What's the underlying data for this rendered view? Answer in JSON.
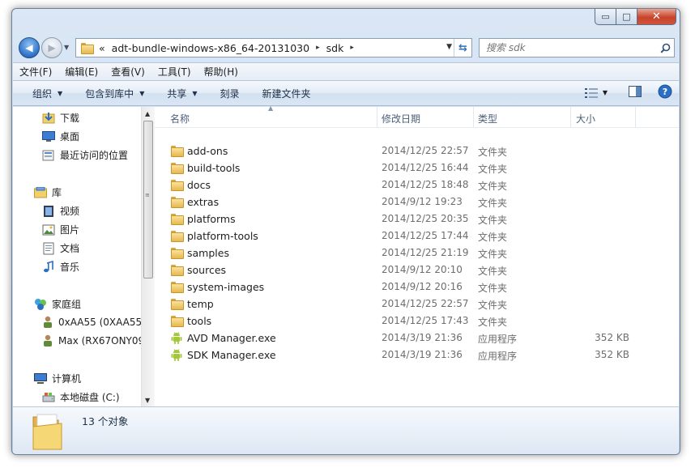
{
  "window": {
    "controls": {
      "minimize": "▭",
      "maximize": "□",
      "close": "✕"
    }
  },
  "address": {
    "overflow": "«",
    "crumbs": [
      "adt-bundle-windows-x86_64-20131030",
      "sdk"
    ],
    "separator": "▸"
  },
  "search": {
    "placeholder": "搜索 sdk"
  },
  "menu": [
    "文件(F)",
    "编辑(E)",
    "查看(V)",
    "工具(T)",
    "帮助(H)"
  ],
  "toolbar": {
    "organize": "组织",
    "include_library": "包含到库中",
    "share": "共享",
    "burn": "刻录",
    "new_folder": "新建文件夹"
  },
  "nav": {
    "favorites": [
      "下载",
      "桌面",
      "最近访问的位置"
    ],
    "library_title": "库",
    "libraries": [
      "视频",
      "图片",
      "文档",
      "音乐"
    ],
    "homegroup_title": "家庭组",
    "homegroup": [
      "0xAA55 (0XAA55-",
      "Max (RX67ONY09"
    ],
    "computer_title": "计算机",
    "computer": [
      "本地磁盘 (C:)"
    ]
  },
  "columns": {
    "name": "名称",
    "date": "修改日期",
    "type": "类型",
    "size": "大小"
  },
  "files": [
    {
      "name": "add-ons",
      "date": "2014/12/25 22:57",
      "type": "文件夹",
      "size": "",
      "icon": "folder-icon"
    },
    {
      "name": "build-tools",
      "date": "2014/12/25 16:44",
      "type": "文件夹",
      "size": "",
      "icon": "folder-icon"
    },
    {
      "name": "docs",
      "date": "2014/12/25 18:48",
      "type": "文件夹",
      "size": "",
      "icon": "folder-icon"
    },
    {
      "name": "extras",
      "date": "2014/9/12 19:23",
      "type": "文件夹",
      "size": "",
      "icon": "folder-icon"
    },
    {
      "name": "platforms",
      "date": "2014/12/25 20:35",
      "type": "文件夹",
      "size": "",
      "icon": "folder-icon"
    },
    {
      "name": "platform-tools",
      "date": "2014/12/25 17:44",
      "type": "文件夹",
      "size": "",
      "icon": "folder-icon"
    },
    {
      "name": "samples",
      "date": "2014/12/25 21:19",
      "type": "文件夹",
      "size": "",
      "icon": "folder-icon"
    },
    {
      "name": "sources",
      "date": "2014/9/12 20:10",
      "type": "文件夹",
      "size": "",
      "icon": "folder-icon"
    },
    {
      "name": "system-images",
      "date": "2014/9/12 20:16",
      "type": "文件夹",
      "size": "",
      "icon": "folder-icon"
    },
    {
      "name": "temp",
      "date": "2014/12/25 22:57",
      "type": "文件夹",
      "size": "",
      "icon": "folder-icon"
    },
    {
      "name": "tools",
      "date": "2014/12/25 17:43",
      "type": "文件夹",
      "size": "",
      "icon": "folder-icon"
    },
    {
      "name": "AVD Manager.exe",
      "date": "2014/3/19 21:36",
      "type": "应用程序",
      "size": "352 KB",
      "icon": "android-icon"
    },
    {
      "name": "SDK Manager.exe",
      "date": "2014/3/19 21:36",
      "type": "应用程序",
      "size": "352 KB",
      "icon": "android-icon"
    }
  ],
  "details": {
    "count": "13 个对象"
  },
  "colors": {
    "android": "#a4c639",
    "accent": "#2f71c7",
    "folder": "#e6b850"
  }
}
